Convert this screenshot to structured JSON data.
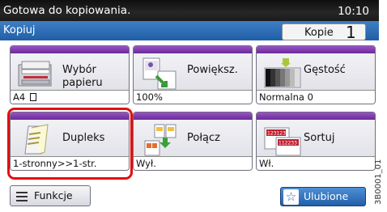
{
  "status": {
    "message": "Gotowa do kopiowania.",
    "time": "10:10"
  },
  "title": {
    "screen": "Kopiuj",
    "copies_label": "Kopie",
    "copies_value": "1"
  },
  "buttons": {
    "paper": {
      "label_line1": "Wybór",
      "label_line2": "papieru",
      "value": "A4",
      "value_icon": "portrait-page-icon"
    },
    "zoom": {
      "label": "Powiększ.",
      "value": "100%"
    },
    "density": {
      "label": "Gęstość",
      "value": "Normalna 0"
    },
    "duplex": {
      "label": "Dupleks",
      "value": "1-stronny>>1-str."
    },
    "combine": {
      "label": "Połącz",
      "value": "Wył."
    },
    "collate": {
      "label": "Sortuj",
      "value": "Wł.",
      "badge_top": "123123",
      "badge_bottom": "112233"
    }
  },
  "bottom": {
    "functions_label": "Funkcje",
    "favorites_label": "Ulubione"
  },
  "side_code": "3B0001_01",
  "colors": {
    "accent_purple": "#7a3aa8",
    "title_blue": "#2c6cb6",
    "highlight_red": "#e01010"
  }
}
